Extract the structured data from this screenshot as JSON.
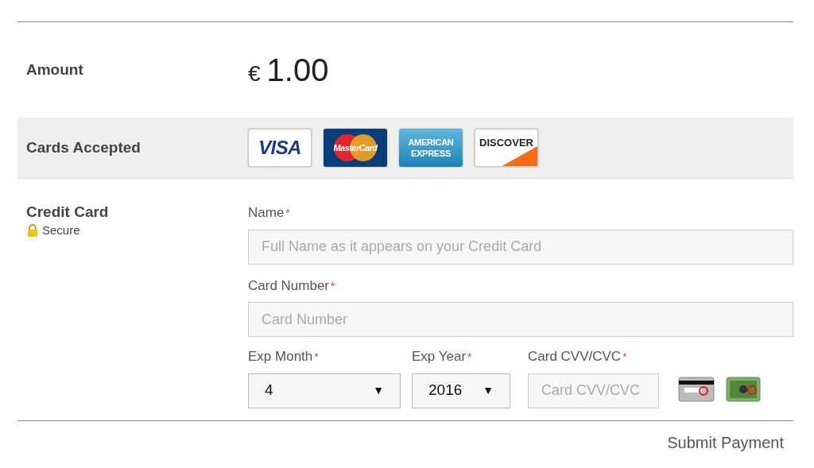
{
  "amount": {
    "label": "Amount",
    "currency": "€",
    "value": "1.00"
  },
  "cards_accepted": {
    "label": "Cards Accepted",
    "cards": [
      {
        "kind": "visa",
        "text": "VISA"
      },
      {
        "kind": "mastercard",
        "text": "MasterCard"
      },
      {
        "kind": "amex",
        "text": "AMERICAN EXPRESS"
      },
      {
        "kind": "discover",
        "text": "DISCOVER"
      }
    ]
  },
  "credit_card": {
    "label": "Credit Card",
    "secure": "Secure",
    "name": {
      "label": "Name",
      "required_mark": "*",
      "placeholder": "Full Name as it appears on your Credit Card"
    },
    "number": {
      "label": "Card Number",
      "required_mark": "*",
      "placeholder": "Card Number"
    },
    "exp_month": {
      "label": "Exp Month",
      "required_mark": "*",
      "value": "4",
      "arrow": "▼"
    },
    "exp_year": {
      "label": "Exp Year",
      "required_mark": "*",
      "value": "2016",
      "arrow": "▼"
    },
    "cvv": {
      "label": "Card CVV/CVC",
      "required_mark": "*",
      "placeholder": "Card CVV/CVC"
    }
  },
  "submit": "Submit Payment"
}
